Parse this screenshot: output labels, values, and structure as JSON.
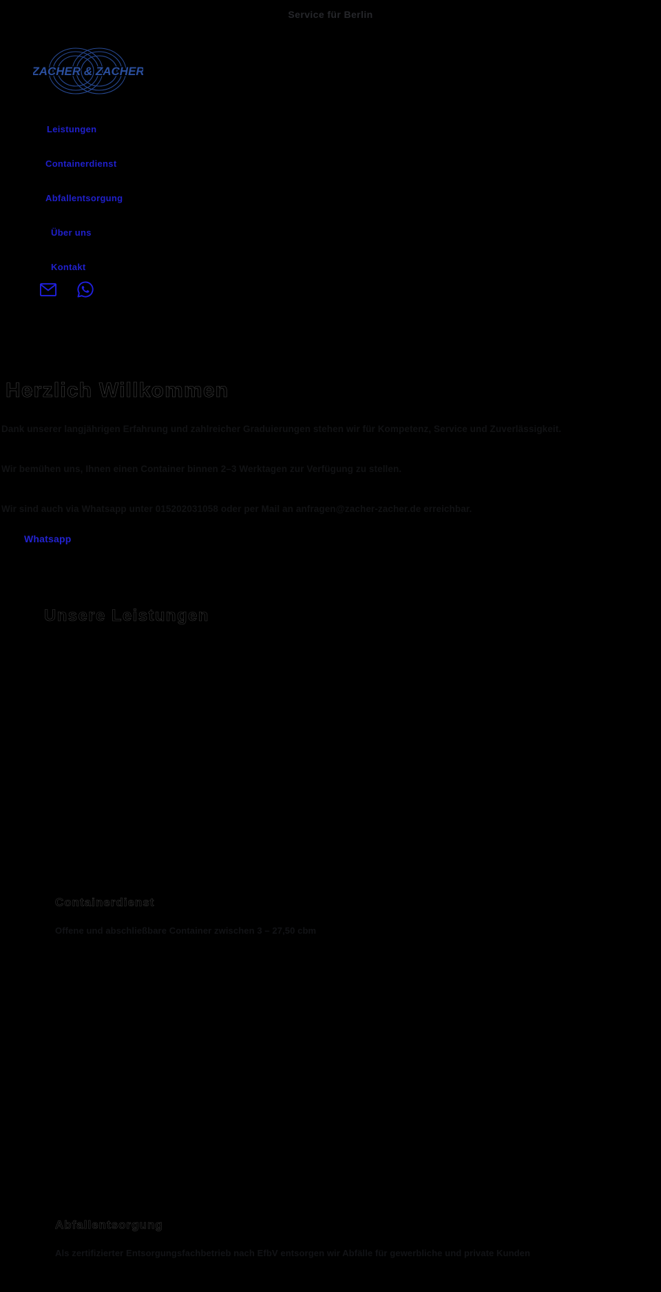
{
  "topbar": {
    "text": "Service für Berlin"
  },
  "logo": {
    "name": "ZACHER & ZACHER",
    "color": "#2b4f9e"
  },
  "nav": {
    "items": [
      {
        "label": "Leistungen",
        "name": "nav-item-leistungen"
      },
      {
        "label": "Containerdienst",
        "name": "nav-item-containerdienst"
      },
      {
        "label": "Abfallentsorgung",
        "name": "nav-item-abfallentsorgung"
      },
      {
        "label": "Über uns",
        "name": "nav-item-ueber-uns"
      },
      {
        "label": "Kontakt",
        "name": "nav-item-kontakt"
      }
    ],
    "link_color": "#2020cc"
  },
  "social": {
    "email_icon": "envelope-icon",
    "whatsapp_icon": "whatsapp-icon",
    "color": "#2020e0"
  },
  "hero": {
    "heading": "Herzlich Willkommen",
    "paragraphs": [
      "Dank unserer langjährigen Erfahrung und zahlreicher Graduierungen stehen wir für Kompetenz, Service und Zuverlässigkeit.",
      "Wir bemühen uns, Ihnen einen Container binnen 2–3 Werktagen zur Verfügung zu stellen.",
      "Wir sind auch via Whatsapp unter 015202031058 oder per Mail an anfragen@zacher-zacher.de erreichbar."
    ],
    "whatsapp_link": "Whatsapp",
    "phone": "015202031058",
    "email": "anfragen@zacher-zacher.de"
  },
  "services": {
    "heading": "Unsere Leistungen",
    "items": [
      {
        "title": "Containerdienst",
        "description": "Offene und abschließbare Container zwischen 3 – 27,50 cbm"
      },
      {
        "title": "Abfallentsorgung",
        "description": "Als zertifizierter Entsorgungsfachbetrieb nach EfbV entsorgen wir Abfälle für gewerbliche und private Kunden"
      }
    ]
  }
}
